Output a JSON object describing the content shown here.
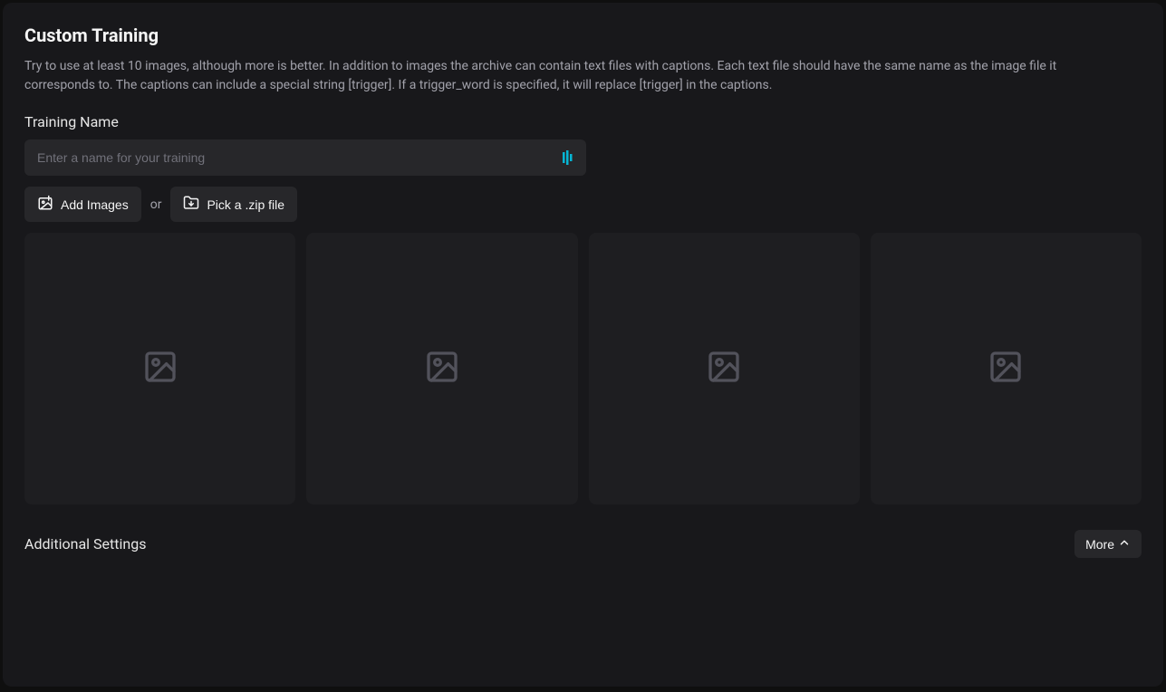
{
  "header": {
    "title": "Custom Training",
    "description": "Try to use at least 10 images, although more is better. In addition to images the archive can contain text files with captions. Each text file should have the same name as the image file it corresponds to. The captions can include a special string [trigger]. If a trigger_word is specified, it will replace [trigger] in the captions."
  },
  "training_name": {
    "label": "Training Name",
    "placeholder": "Enter a name for your training",
    "value": ""
  },
  "buttons": {
    "add_images": "Add Images",
    "or_text": "or",
    "pick_zip": "Pick a .zip file"
  },
  "image_slots": {
    "count": 4
  },
  "settings": {
    "label": "Additional Settings",
    "more_button": "More"
  }
}
